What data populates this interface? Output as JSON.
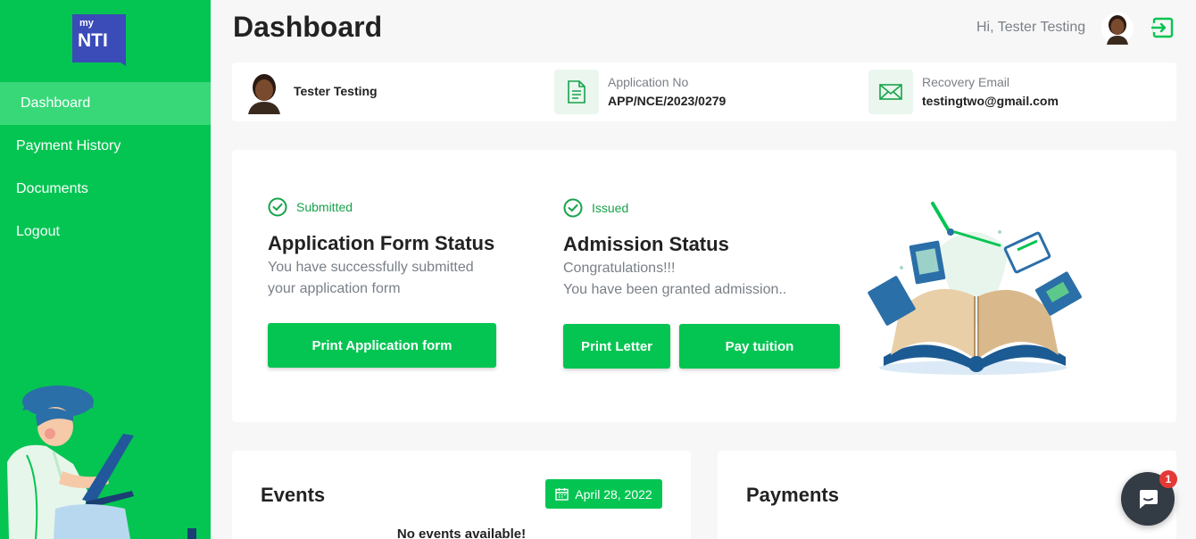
{
  "brand": {
    "logo_small": "my",
    "logo_big": "NTI"
  },
  "sidebar": {
    "items": [
      {
        "label": "Dashboard",
        "active": true
      },
      {
        "label": "Payment History",
        "active": false
      },
      {
        "label": "Documents",
        "active": false
      },
      {
        "label": "Logout",
        "active": false
      }
    ]
  },
  "header": {
    "title": "Dashboard",
    "greeting": "Hi, Tester Testing"
  },
  "profile": {
    "name": "Tester Testing",
    "application_label": "Application No",
    "application_no": "APP/NCE/2023/0279",
    "email_label": "Recovery Email",
    "email": "testingtwo@gmail.com"
  },
  "application_status": {
    "badge": "Submitted",
    "title": "Application Form Status",
    "desc_line1": "You have successfully submitted",
    "desc_line2": "your application form",
    "button": "Print Application form"
  },
  "admission_status": {
    "badge": "Issued",
    "title": "Admission Status",
    "desc_line1": "Congratulations!!!",
    "desc_line2": "You have been granted admission..",
    "button_letter": "Print Letter",
    "button_tuition": "Pay tuition"
  },
  "events": {
    "title": "Events",
    "date": "April 28, 2022",
    "empty": "No events available!"
  },
  "payments": {
    "title": "Payments"
  },
  "chat": {
    "badge_count": "1"
  },
  "colors": {
    "primary": "#04c552",
    "sidebar_active": "#38d879",
    "muted": "#7a8088"
  }
}
